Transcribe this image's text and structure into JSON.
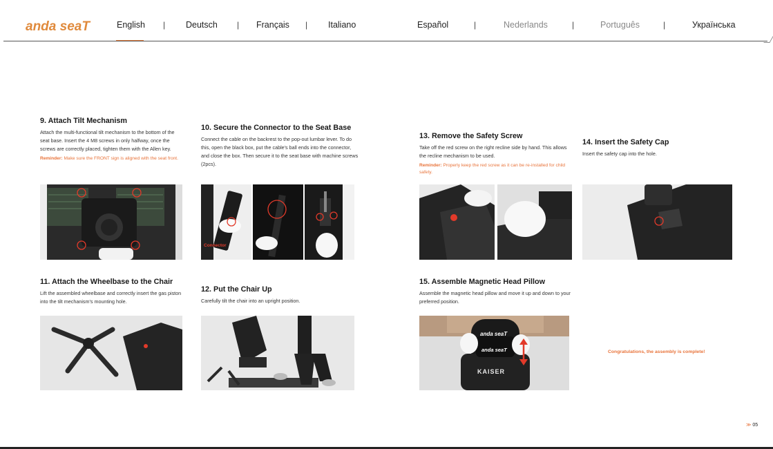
{
  "header": {
    "logo_text": "anda seaT",
    "languages": [
      {
        "label": "English",
        "active": true
      },
      {
        "label": "Deutsch",
        "active": false
      },
      {
        "label": "Français",
        "active": false
      },
      {
        "label": "Italiano",
        "active": false
      },
      {
        "label": "Español",
        "active": false
      },
      {
        "label": "Nederlands",
        "active": false
      },
      {
        "label": "Português",
        "active": false
      },
      {
        "label": "Українська",
        "active": false
      }
    ],
    "separator": "|",
    "accent_color": "#e07a3a"
  },
  "steps": [
    {
      "title": "9. Attach Tilt Mechanism",
      "body": "Attach the multi-functional tilt mechanism to the bottom of the seat base. Insert the 4 M8 screws in only halfway, once the screws are correctly placed, tighten them with the Allen key.",
      "reminder_label": "Reminder:",
      "reminder_text": " Make sure the FRONT sign is aligned with the seat front."
    },
    {
      "title": "10. Secure the Connector to the Seat Base",
      "body": "Connect the cable on the backrest to the pop-out lumbar lever. To do this, open the black box, put the cable's ball ends into the connector, and close the box. Then secure it to the seat base with machine screws (2pcs).",
      "photo_label": "Connector"
    },
    {
      "title": "13. Remove the Safety Screw",
      "body": "Take off the red screw on the right recline side by hand. This allows the recline mechanism to be used.",
      "reminder_label": "Reminder:",
      "reminder_text": " Properly keep the red screw as it can be re-installed for child safety."
    },
    {
      "title": "14. Insert the Safety Cap",
      "body": "Insert the safety cap into the hole."
    },
    {
      "title": "11. Attach the Wheelbase to the Chair",
      "body": "Lift the assembled wheelbase and correctly insert the gas piston into the tilt mechanism's mounting hole."
    },
    {
      "title": "12. Put the Chair Up",
      "body": "Carefully tilt the chair into an upright position."
    },
    {
      "title": "15. Assemble Magnetic Head Pillow",
      "body": "Assemble the magnetic head pillow and move it up and down to your preferred position.",
      "pillow_logo_1": "anda seaT",
      "pillow_logo_2": "anda seaT",
      "chair_brand": "KAISER"
    }
  ],
  "congrats": "Congratulations, the assembly is complete!",
  "page_number": "05",
  "page_mark": "≫"
}
